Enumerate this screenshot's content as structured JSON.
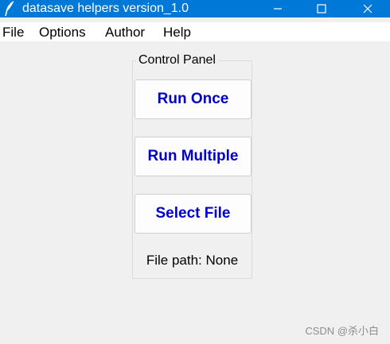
{
  "window": {
    "title": "datasave helpers version_1.0",
    "icon": "feather-icon",
    "titlebar_color": "#0078d7"
  },
  "menu": {
    "items": [
      "File",
      "Options",
      "Author",
      "Help"
    ]
  },
  "control_panel": {
    "label": "Control Panel",
    "buttons": [
      "Run Once",
      "Run Multiple",
      "Select File"
    ],
    "button_text_color": "#0000cd",
    "file_path_label": "File path:",
    "file_path_value": "None"
  },
  "watermark": "CSDN @杀小白"
}
